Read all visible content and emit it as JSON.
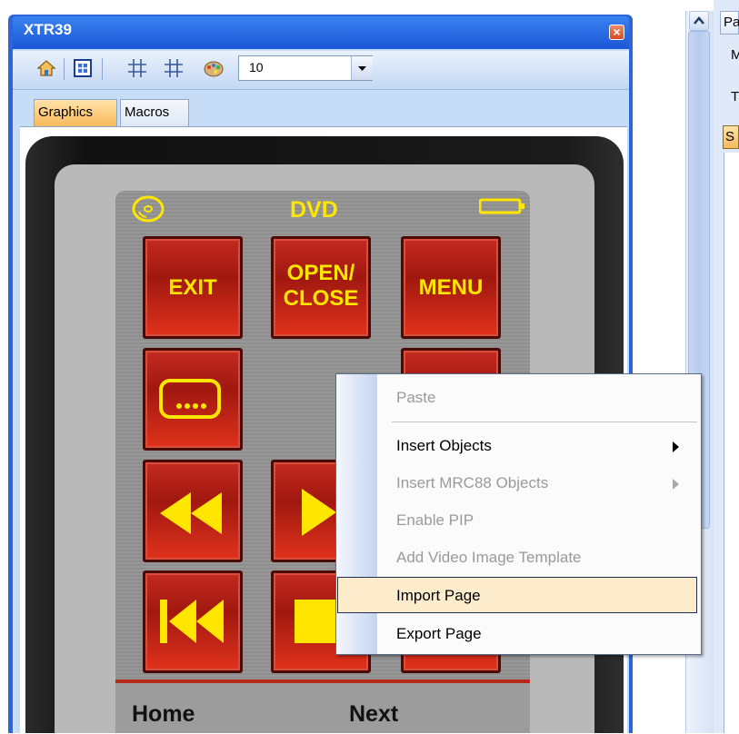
{
  "window": {
    "title": "XTR39",
    "close_icon": "close-icon"
  },
  "toolbar": {
    "icons": [
      "home-icon",
      "grid-icon",
      "grid-lines-icon",
      "snap-icon",
      "palette-icon"
    ],
    "zoom_value": "10"
  },
  "tabs": [
    {
      "label": "Graphics",
      "active": true
    },
    {
      "label": "Macros",
      "active": false
    }
  ],
  "remote": {
    "device_label": "DVD",
    "icons": [
      "disc-icon",
      "battery-icon"
    ],
    "buttons": {
      "exit": "EXIT",
      "open_close_line1": "OPEN/",
      "open_close_line2": "CLOSE",
      "menu": "MENU"
    },
    "icon_buttons": [
      "subtitle-icon",
      "rewind-icon",
      "play-icon",
      "skip-back-icon",
      "stop-icon"
    ],
    "footer": {
      "left": "Home",
      "right": "Next"
    },
    "colors": {
      "button_red": "#c42a20",
      "label_yellow": "#ffe600"
    }
  },
  "right_panel": {
    "tab_label": "Pa",
    "row1": "M",
    "row2": "T",
    "row3": "S"
  },
  "context_menu": {
    "items": [
      {
        "label": "Paste",
        "enabled": false
      },
      {
        "label": "Insert Objects",
        "enabled": true,
        "submenu": true
      },
      {
        "label": "Insert MRC88 Objects",
        "enabled": false,
        "submenu": true
      },
      {
        "label": "Enable PIP",
        "enabled": false
      },
      {
        "label": "Add Video Image Template",
        "enabled": false
      },
      {
        "label": "Import Page",
        "enabled": true,
        "highlighted": true
      },
      {
        "label": "Export Page",
        "enabled": true
      }
    ]
  },
  "colors": {
    "title_bar": "#2c66d8",
    "menu_highlight": "#fdeccc",
    "active_tab": "#f7b95c"
  }
}
